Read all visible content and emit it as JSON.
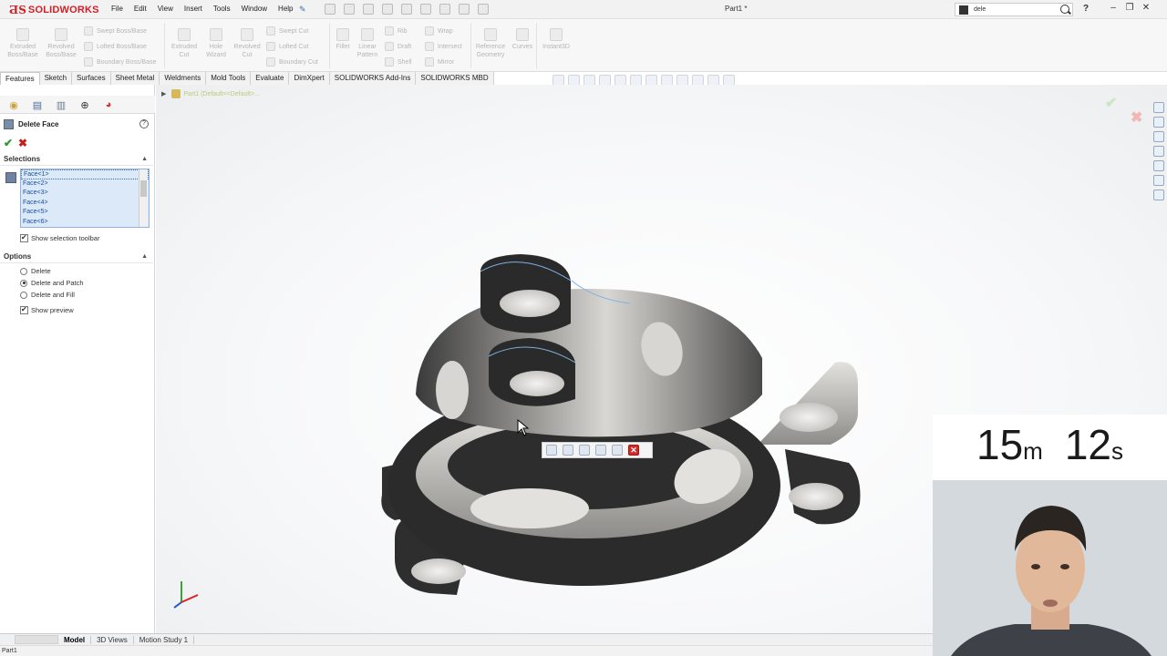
{
  "app": {
    "brand": "SOLIDWORKS",
    "document_title": "Part1 *",
    "menu": [
      "File",
      "Edit",
      "View",
      "Insert",
      "Tools",
      "Window",
      "Help"
    ],
    "search_value": "dele"
  },
  "toolbar": {
    "features": {
      "extruded_boss": "Extruded Boss/Base",
      "revolved_boss": "Revolved Boss/Base",
      "swept_boss": "Swept Boss/Base",
      "lofted_boss": "Lofted Boss/Base",
      "boundary_boss": "Boundary Boss/Base",
      "extruded_cut": "Extruded Cut",
      "hole_wizard": "Hole Wizard",
      "revolved_cut": "Revolved Cut",
      "swept_cut": "Swept Cut",
      "lofted_cut": "Lofted Cut",
      "boundary_cut": "Boundary Cut",
      "fillet": "Fillet",
      "linear_pattern": "Linear Pattern",
      "rib": "Rib",
      "draft": "Draft",
      "shell": "Shell",
      "wrap": "Wrap",
      "intersect": "Intersect",
      "mirror": "Mirror",
      "reference_geometry": "Reference Geometry",
      "curves": "Curves",
      "instant3d": "Instant3D"
    }
  },
  "tabs": [
    "Features",
    "Sketch",
    "Surfaces",
    "Sheet Metal",
    "Weldments",
    "Mold Tools",
    "Evaluate",
    "DimXpert",
    "SOLIDWORKS Add-Ins",
    "SOLIDWORKS MBD"
  ],
  "property_manager": {
    "title": "Delete Face",
    "selections_label": "Selections",
    "faces": [
      "Face<1>",
      "Face<2>",
      "Face<3>",
      "Face<4>",
      "Face<5>",
      "Face<6>"
    ],
    "show_selection_toolbar": "Show selection toolbar",
    "options_label": "Options",
    "option_delete": "Delete",
    "option_delete_patch": "Delete and Patch",
    "option_delete_fill": "Delete and Fill",
    "show_preview": "Show preview",
    "selected_option": "Delete and Patch"
  },
  "graphics": {
    "tree_flyout": "Part1  (Default<<Default>...",
    "context_toolbar_icons": [
      "select-loop-icon",
      "select-tangency-icon",
      "select-chain-icon",
      "select-partial-loop-icon",
      "select-other-icon",
      "close-icon"
    ]
  },
  "bottom_tabs": [
    "Model",
    "3D Views",
    "Motion Study 1"
  ],
  "status": "Part1",
  "timer": {
    "minutes": "15",
    "minutes_unit": "m",
    "seconds": "12",
    "seconds_unit": "s"
  },
  "colors": {
    "brand_red": "#d21f25",
    "selection_blue": "#1a4fa0",
    "ok_green": "#2e9a2e"
  }
}
